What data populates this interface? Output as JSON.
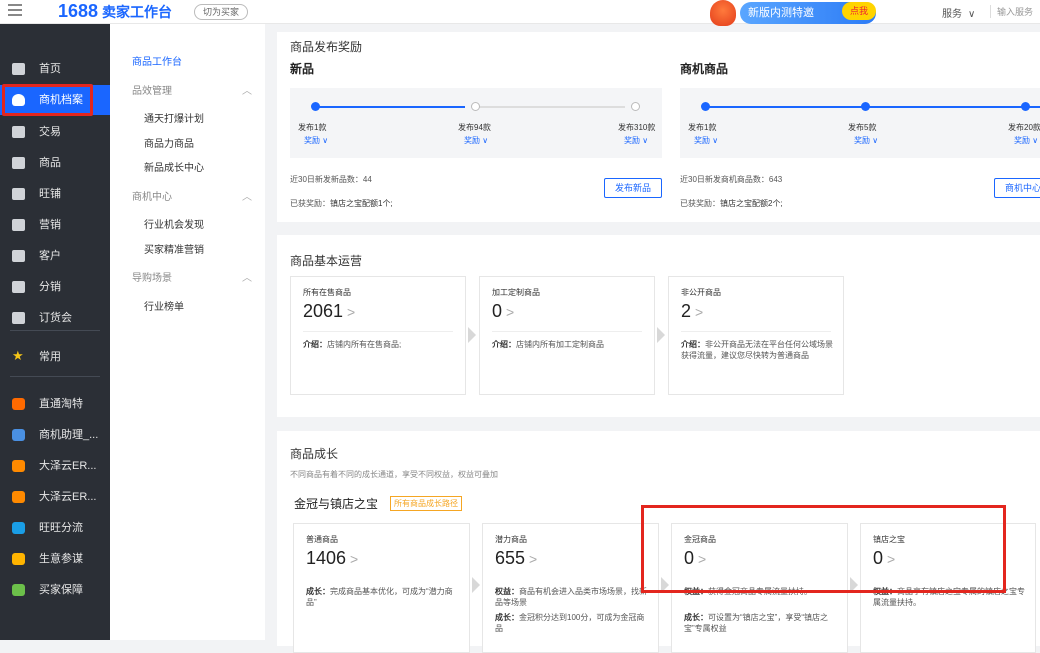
{
  "topbar": {
    "logo_number": "1688",
    "logo_text": "卖家工作台",
    "switch_label": "切为买家",
    "promo_label": "新版内测特邀",
    "promo_click": "点我",
    "service_label": "服务",
    "search_hint": "输入服务"
  },
  "sidebar": {
    "items": [
      {
        "label": "首页",
        "icon": "home-icon"
      },
      {
        "label": "商机档案",
        "icon": "crown-icon",
        "active": true
      },
      {
        "label": "交易",
        "icon": "order-icon"
      },
      {
        "label": "商品",
        "icon": "product-icon"
      },
      {
        "label": "旺铺",
        "icon": "shop-icon"
      },
      {
        "label": "营销",
        "icon": "tag-icon"
      },
      {
        "label": "客户",
        "icon": "user-icon"
      },
      {
        "label": "分销",
        "icon": "share-icon"
      },
      {
        "label": "订货会",
        "icon": "box-icon"
      },
      {
        "label": "常用",
        "icon": "star-icon"
      },
      {
        "label": "直通淘特",
        "icon": "tao-app-icon"
      },
      {
        "label": "商机助理_...",
        "icon": "assistant-app-icon"
      },
      {
        "label": "大泽云ER...",
        "icon": "erp-app-icon"
      },
      {
        "label": "大泽云ER...",
        "icon": "erp-app-icon-2"
      },
      {
        "label": "旺旺分流",
        "icon": "wangwang-app-icon"
      },
      {
        "label": "生意参谋",
        "icon": "analytics-app-icon"
      },
      {
        "label": "买家保障",
        "icon": "guarantee-app-icon"
      }
    ]
  },
  "subnav": {
    "head": "商品工作台",
    "groups": [
      {
        "label": "品效管理",
        "links": [
          "通天打爆计划",
          "商品力商品",
          "新品成长中心"
        ]
      },
      {
        "label": "商机中心",
        "links": [
          "行业机会发现",
          "买家精准营销"
        ]
      },
      {
        "label": "导购场景",
        "links": [
          "行业榜单"
        ]
      }
    ]
  },
  "reward_card": {
    "title": "商品发布奖励",
    "new": {
      "title": "新品",
      "steps": [
        "发布1款",
        "发布94款",
        "发布310款"
      ],
      "reward_label": "奖励 ∨",
      "stat": "近30日新发新品数：44",
      "earned_prefix": "已获奖励：",
      "earned_value": "镇店之宝配额1个;",
      "button": "发布新品"
    },
    "biz": {
      "title": "商机商品",
      "steps": [
        "发布1款",
        "发布5款",
        "发布20款"
      ],
      "reward_label": "奖励 ∨",
      "stat": "近30日新发商机商品数：643",
      "earned_prefix": "已获奖励：",
      "earned_value": "镇店之宝配额2个;",
      "button": "商机中心"
    }
  },
  "basic_ops": {
    "title": "商品基本运营",
    "boxes": [
      {
        "label": "所有在售商品",
        "value": "2061",
        "desc_key": "介绍：",
        "desc": "店铺内所有在售商品;"
      },
      {
        "label": "加工定制商品",
        "value": "0",
        "desc_key": "介绍：",
        "desc": "店铺内所有加工定制商品"
      },
      {
        "label": "非公开商品",
        "value": "2",
        "desc_key": "介绍：",
        "desc": "非公开商品无法在平台任何公域场景获得流量，建议您尽快转为普通商品"
      }
    ]
  },
  "growth": {
    "title": "商品成长",
    "hint": "不同商品有着不同的成长通道，享受不同权益，权益可叠加",
    "crown_title": "金冠与镇店之宝",
    "path_tag": "所有商品成长路径",
    "boxes": [
      {
        "label": "普通商品",
        "value": "1406",
        "lines": [
          {
            "k": "成长：",
            "v": "完成商品基本优化，可成为“潜力商品”"
          }
        ]
      },
      {
        "label": "潜力商品",
        "value": "655",
        "lines": [
          {
            "k": "权益：",
            "v": "商品有机会进入品类市场场景，找新品等场景"
          },
          {
            "k": "成长：",
            "v": "金冠积分达到100分，可成为金冠商品"
          }
        ]
      },
      {
        "label": "金冠商品",
        "value": "0",
        "lines": [
          {
            "k": "权益：",
            "v": "获得金冠商品专属流量扶持。"
          },
          {
            "k": "成长：",
            "v": "可设置为“镇店之宝”，享受“镇店之宝”专属权益"
          }
        ]
      },
      {
        "label": "镇店之宝",
        "value": "0",
        "lines": [
          {
            "k": "权益：",
            "v": "商品享有镇店之宝专属的镇店之宝专属流量扶持。"
          }
        ]
      }
    ]
  },
  "colors": {
    "accent": "#1a66ff",
    "sidebar_bg": "#2b2f36",
    "highlight": "#e3261e"
  }
}
